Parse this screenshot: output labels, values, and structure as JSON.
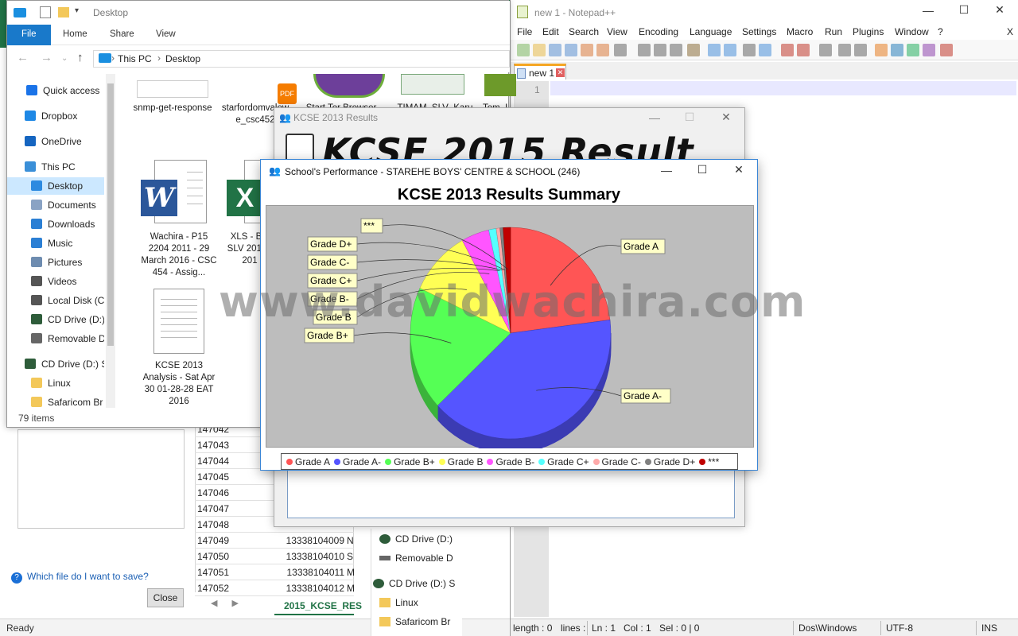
{
  "excel": {
    "status_left": "Ready",
    "sheet_tab": "2015_KCSE_RES",
    "rows": [
      {
        "a": "147042",
        "b": "",
        "c": ""
      },
      {
        "a": "147043",
        "b": "",
        "c": ""
      },
      {
        "a": "147044",
        "b": "",
        "c": ""
      },
      {
        "a": "147045",
        "b": "",
        "c": ""
      },
      {
        "a": "147046",
        "b": "",
        "c": ""
      },
      {
        "a": "147047",
        "b": "",
        "c": ""
      },
      {
        "a": "147048",
        "b": "",
        "c": ""
      },
      {
        "a": "147049",
        "b": "13338104009",
        "c": "N"
      },
      {
        "a": "147050",
        "b": "13338104010",
        "c": "S"
      },
      {
        "a": "147051",
        "b": "13338104011",
        "c": "M"
      },
      {
        "a": "147052",
        "b": "13338104012",
        "c": "M"
      }
    ]
  },
  "save_dialog": {
    "help_link": "Which file do I want to save?",
    "close_button": "Close"
  },
  "nav2": {
    "items": [
      "CD Drive (D:)",
      "Removable D",
      "CD Drive (D:) S",
      "Linux",
      "Safaricom Br"
    ]
  },
  "explorer": {
    "title": "Desktop",
    "ribbon_tabs": [
      "File",
      "Home",
      "Share",
      "View"
    ],
    "address": {
      "root": "This PC",
      "current": "Desktop"
    },
    "nav_items": [
      {
        "label": "Quick access",
        "icon": "star-icon",
        "color": "#1a73e8"
      },
      {
        "label": "Dropbox",
        "icon": "dropbox-icon",
        "color": "#1e88e5"
      },
      {
        "label": "OneDrive",
        "icon": "cloud-icon",
        "color": "#1565c0"
      },
      {
        "label": "This PC",
        "icon": "computer-icon",
        "color": "#3a8fd8"
      },
      {
        "label": "Desktop",
        "icon": "desktop-icon",
        "color": "#2d8ae0"
      },
      {
        "label": "Documents",
        "icon": "documents-icon",
        "color": "#8aa3c4"
      },
      {
        "label": "Downloads",
        "icon": "downloads-icon",
        "color": "#2b7fd4"
      },
      {
        "label": "Music",
        "icon": "music-icon",
        "color": "#2b7fd4"
      },
      {
        "label": "Pictures",
        "icon": "pictures-icon",
        "color": "#6e8cb0"
      },
      {
        "label": "Videos",
        "icon": "videos-icon",
        "color": "#555"
      },
      {
        "label": "Local Disk (C",
        "icon": "disk-icon",
        "color": "#555"
      },
      {
        "label": "CD Drive (D:)",
        "icon": "cd-icon",
        "color": "#2e5c3a"
      },
      {
        "label": "Removable D",
        "icon": "usb-icon",
        "color": "#666"
      },
      {
        "label": "CD Drive (D:) S",
        "icon": "cd-icon",
        "color": "#2e5c3a"
      },
      {
        "label": "Linux",
        "icon": "folder-icon",
        "color": "#f3c85a"
      },
      {
        "label": "Safaricom Br",
        "icon": "folder-icon",
        "color": "#f3c85a"
      }
    ],
    "files": [
      {
        "name": "snmp-get-response"
      },
      {
        "name": "starfordomvalow e_csc452"
      },
      {
        "name": "Start Tor Browser"
      },
      {
        "name": "TIMAM_SLV_Karu"
      },
      {
        "name": "Tom_L"
      },
      {
        "name": "Wachira - P15 2204 2011 - 29 March 2016 - CSC 454 - Assig..."
      },
      {
        "name": "XLS - Bul SLV 2016 - 201"
      },
      {
        "name": "KCSE 2013 Analysis - Sat Apr 30 01-28-28 EAT 2016"
      }
    ],
    "items_count": "79 items"
  },
  "notepadpp": {
    "title": "new 1 - Notepad++",
    "menu": [
      "File",
      "Edit",
      "Search",
      "View",
      "Encoding",
      "Language",
      "Settings",
      "Macro",
      "Run",
      "Plugins",
      "Window",
      "?"
    ],
    "close_menu": "X",
    "tab_label": "new 1",
    "line_number": "1",
    "status": {
      "length": "length : 0",
      "lines": "lines :",
      "ln": "Ln : 1",
      "col": "Col : 1",
      "sel": "Sel : 0 | 0",
      "eol": "Dos\\Windows",
      "encoding": "UTF-8",
      "mode": "INS"
    }
  },
  "kcse_window": {
    "title": "KCSE 2013 Results",
    "banner": "KCSE 2015 Result"
  },
  "perf_window": {
    "title": "School's Performance - STAREHE BOYS' CENTRE & SCHOOL (246)"
  },
  "watermark": "www.davidwachira.com",
  "chart_data": {
    "type": "pie",
    "title": "KCSE 2013 Results Summary",
    "pie_style": "3d",
    "legend_position": "bottom",
    "categories": [
      "Grade A",
      "Grade A-",
      "Grade B+",
      "Grade B",
      "Grade B-",
      "Grade C+",
      "Grade C-",
      "Grade D+",
      "***"
    ],
    "values": [
      23,
      40,
      19,
      10,
      4.5,
      1.2,
      0.6,
      0.5,
      1.2
    ],
    "colors": [
      "#ff5555",
      "#5555ff",
      "#55ff55",
      "#ffff55",
      "#ff55ff",
      "#55ffff",
      "#ffaaaa",
      "#808080",
      "#c00000"
    ],
    "callout_labels": [
      "Grade A",
      "Grade A-",
      "Grade B+",
      "Grade B",
      "Grade B-",
      "Grade C+",
      "Grade C-",
      "Grade D+",
      "***"
    ]
  }
}
